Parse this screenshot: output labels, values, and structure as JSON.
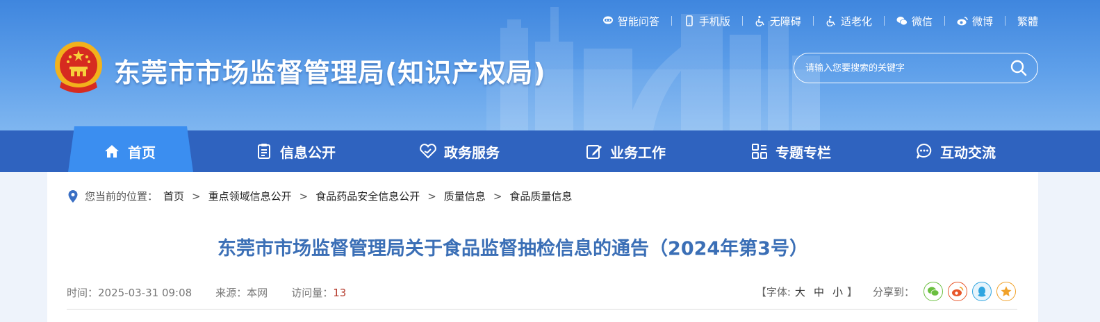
{
  "header": {
    "site_title": "东莞市市场监督管理局(知识产权局)",
    "top_links": [
      {
        "label": "智能问答",
        "icon": "chat-bot-icon"
      },
      {
        "label": "手机版",
        "icon": "mobile-icon"
      },
      {
        "label": "无障碍",
        "icon": "wheelchair-icon"
      },
      {
        "label": "适老化",
        "icon": "elderly-icon"
      },
      {
        "label": "微信",
        "icon": "wechat-icon"
      },
      {
        "label": "微博",
        "icon": "weibo-icon"
      },
      {
        "label": "繁體",
        "icon": ""
      }
    ],
    "search": {
      "placeholder": "请输入您要搜索的关键字"
    }
  },
  "nav": {
    "items": [
      {
        "label": "首页",
        "icon": "home-icon",
        "active": true
      },
      {
        "label": "信息公开",
        "icon": "clipboard-icon"
      },
      {
        "label": "政务服务",
        "icon": "heart-handshake-icon"
      },
      {
        "label": "业务工作",
        "icon": "edit-icon"
      },
      {
        "label": "专题专栏",
        "icon": "grid-icon"
      },
      {
        "label": "互动交流",
        "icon": "chat-bubble-icon"
      }
    ]
  },
  "breadcrumb": {
    "lead": "您当前的位置：",
    "items": [
      "首页",
      "重点领域信息公开",
      "食品药品安全信息公开",
      "质量信息",
      "食品质量信息"
    ],
    "separator": ">"
  },
  "article": {
    "title": "东莞市市场监督管理局关于食品监督抽检信息的通告（2024年第3号）",
    "time": "时间：2025-03-31 09:08",
    "source": "来源：本网",
    "views_label": "访问量：",
    "views": "13"
  },
  "tools": {
    "font_size_open": "【字体:",
    "font_sizes": [
      "大",
      "中",
      "小"
    ],
    "font_size_close": "】",
    "share_label": "分享到：",
    "share_targets": [
      {
        "icon": "wechat-icon",
        "color": "#6abf3f"
      },
      {
        "icon": "weibo-icon",
        "color": "#e8562a"
      },
      {
        "icon": "qq-icon",
        "color": "#2fa5e0"
      },
      {
        "icon": "favorite-star-icon",
        "color": "#f1a22a"
      }
    ]
  },
  "colors": {
    "header_blue": "#3f86de",
    "nav_blue": "#2f63bf",
    "nav_active": "#3b8ef0",
    "title_blue": "#3b6fb6",
    "views_red": "#b53a2c"
  }
}
